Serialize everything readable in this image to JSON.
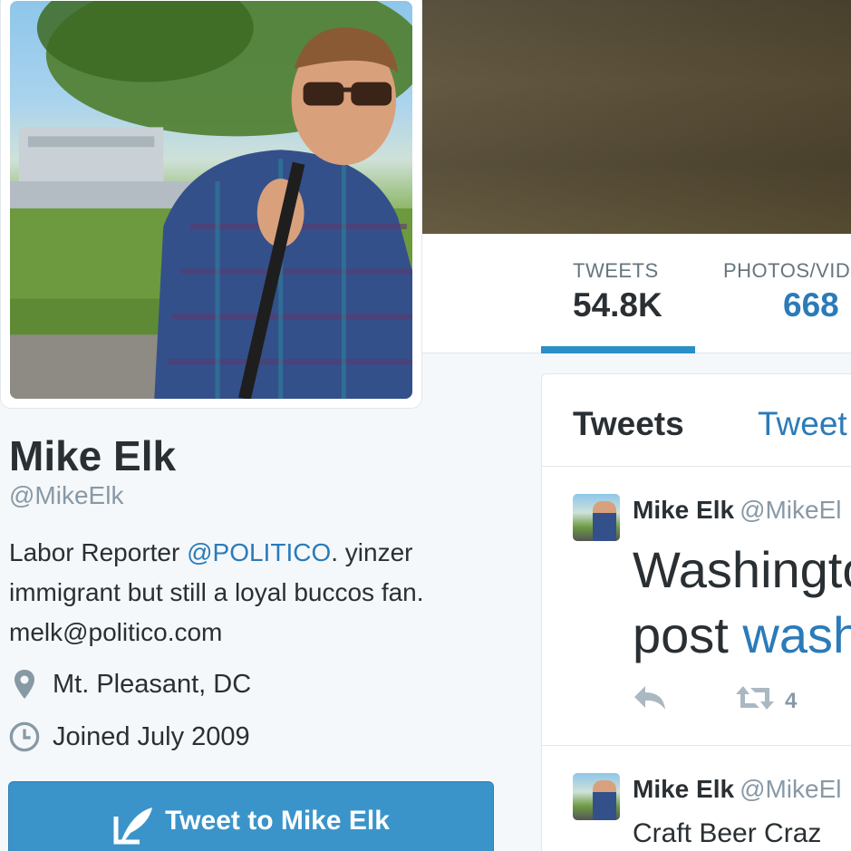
{
  "profile": {
    "name": "Mike Elk",
    "handle": "@MikeElk",
    "bio_prefix": "Labor Reporter ",
    "bio_mention": "@POLITICO",
    "bio_rest": ". yinzer immigrant but still a loyal buccos fan. melk@politico.com",
    "location": "Mt. Pleasant, DC",
    "joined": "Joined July 2009",
    "tweet_to_label": "Tweet to Mike Elk"
  },
  "nav": {
    "stats": [
      {
        "label": "TWEETS",
        "value": "54.8K"
      },
      {
        "label": "PHOTOS/VID",
        "value": "668"
      }
    ]
  },
  "timeline": {
    "tabs": [
      "Tweets",
      "Tweet"
    ],
    "tweets": [
      {
        "name": "Mike Elk",
        "handle": "@MikeEl",
        "text_line1": "Washingto",
        "text_line2_prefix": "post ",
        "text_line2_link": "wash",
        "retweets": "4"
      },
      {
        "name": "Mike Elk",
        "handle": "@MikeEl",
        "text_line1": "Craft Beer Craz"
      }
    ]
  },
  "colors": {
    "link": "#2b7bb9",
    "button": "#3b94c9",
    "tab_underline": "#2a8fc7",
    "muted": "#8899a6"
  },
  "icons": [
    "location-pin-icon",
    "clock-icon",
    "feather-compose-icon",
    "reply-icon",
    "retweet-icon"
  ]
}
